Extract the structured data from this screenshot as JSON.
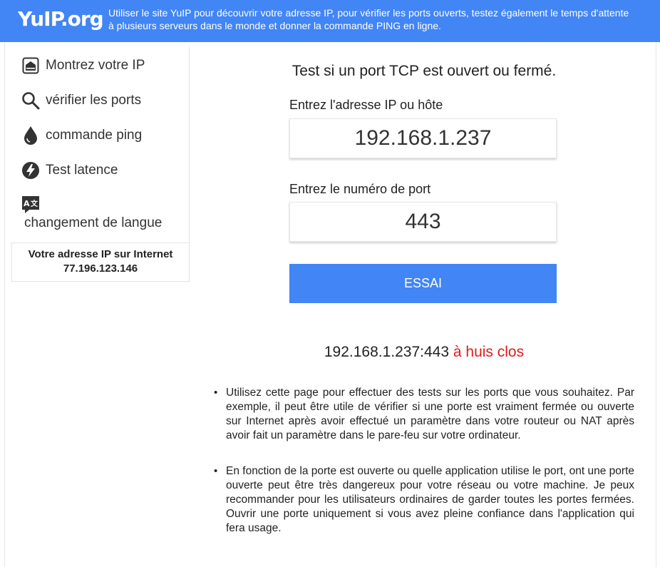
{
  "header": {
    "logo": "YuIP.org",
    "tagline": "Utiliser le site YuIP pour découvrir votre adresse IP, pour vérifier les ports ouverts, testez également le temps d'attente à plusieurs serveurs dans le monde et donner la commande PING en ligne."
  },
  "sidebar": {
    "items": [
      {
        "label": "Montrez votre IP",
        "icon": "router-icon"
      },
      {
        "label": "vérifier les ports",
        "icon": "search-icon"
      },
      {
        "label": "commande ping",
        "icon": "drop-icon"
      },
      {
        "label": "Test latence",
        "icon": "lightning-icon"
      },
      {
        "label": "changement de langue",
        "icon": "translate-icon"
      }
    ]
  },
  "ip_box": {
    "title": "Votre adresse IP sur Internet",
    "ip": "77.196.123.146"
  },
  "main": {
    "title": "Test si un port TCP est ouvert ou fermé.",
    "host_label": "Entrez l'adresse IP ou hôte",
    "host_value": "192.168.1.237",
    "port_label": "Entrez le numéro de port",
    "port_value": "443",
    "button_label": "ESSAI",
    "result_target": "192.168.1.237:443",
    "result_status": "à huis clos",
    "info": [
      "Utilisez cette page pour effectuer des tests sur les ports que vous souhaitez. Par exemple, il peut être utile de vérifier si une porte est vraiment fermée ou ouverte sur Internet après avoir effectué un paramètre dans votre routeur ou NAT après avoir fait un paramètre dans le pare-feu sur votre ordinateur.",
      "En fonction de la porte est ouverte ou quelle application utilise le port, ont une porte ouverte peut être très dangereux pour votre réseau ou votre machine. Je peux recommander pour les utilisateurs ordinaires de garder toutes les portes fermées. Ouvrir une porte uniquement si vous avez pleine confiance dans l'application qui fera usage."
    ]
  },
  "colors": {
    "brand": "#4285f4",
    "status_closed": "#e01b1b"
  }
}
